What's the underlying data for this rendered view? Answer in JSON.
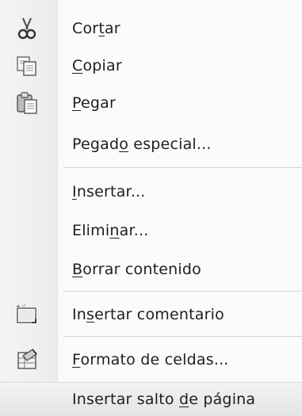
{
  "menu": {
    "items": [
      {
        "pre": "Cor",
        "u": "t",
        "post": "ar",
        "icon": "scissors-icon"
      },
      {
        "pre": "",
        "u": "C",
        "post": "opiar",
        "icon": "copy-icon"
      },
      {
        "pre": "",
        "u": "P",
        "post": "egar",
        "icon": "paste-icon"
      },
      {
        "pre": "Pegad",
        "u": "o",
        "post": " especial...",
        "icon": ""
      },
      {
        "pre": "",
        "u": "I",
        "post": "nsertar...",
        "icon": ""
      },
      {
        "pre": "Elimi",
        "u": "n",
        "post": "ar...",
        "icon": ""
      },
      {
        "pre": "",
        "u": "B",
        "post": "orrar contenido",
        "icon": ""
      },
      {
        "pre": "In",
        "u": "s",
        "post": "ertar comentario",
        "icon": "insert-comment-icon"
      },
      {
        "pre": "",
        "u": "F",
        "post": "ormato de celdas...",
        "icon": "format-cells-icon"
      },
      {
        "pre": "Insertar salto ",
        "u": "d",
        "post": "e página",
        "icon": ""
      }
    ]
  }
}
